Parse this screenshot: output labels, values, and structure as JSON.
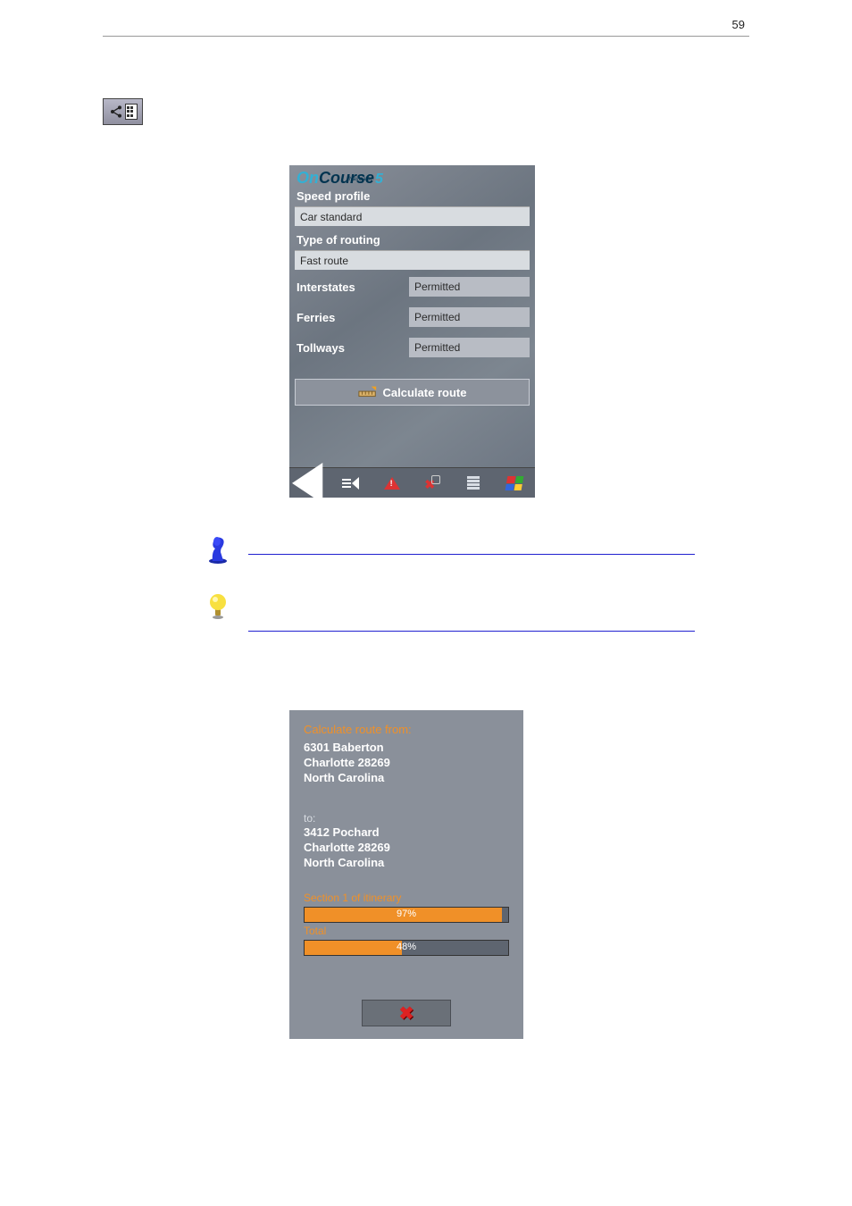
{
  "header": {
    "page_number": "59"
  },
  "doc_icons": {
    "calc_tool_icon": "route-calc-icon"
  },
  "screenshot1": {
    "logo_on": "On",
    "logo_course": "Course",
    "logo_5": "5",
    "logo_nav": "Navigator",
    "labels": {
      "speed_profile": "Speed profile",
      "type_of_routing": "Type of routing",
      "interstates": "Interstates",
      "ferries": "Ferries",
      "tollways": "Tollways"
    },
    "values": {
      "speed_profile": "Car standard",
      "type_of_routing": "Fast route",
      "interstates": "Permitted",
      "ferries": "Permitted",
      "tollways": "Permitted"
    },
    "calc_button": "Calculate route"
  },
  "screenshot2": {
    "title": "Calculate route from:",
    "from_addr_l1": "6301 Baberton",
    "from_addr_l2": "Charlotte 28269",
    "from_addr_l3": "North Carolina",
    "to_label": "to:",
    "to_addr_l1": "3412 Pochard",
    "to_addr_l2": "Charlotte 28269",
    "to_addr_l3": "North Carolina",
    "section_label": "Section 1 of itinerary",
    "section_pct_text": "97%",
    "section_pct": 97,
    "total_label": "Total",
    "total_pct_text": "48%",
    "total_pct": 48
  }
}
